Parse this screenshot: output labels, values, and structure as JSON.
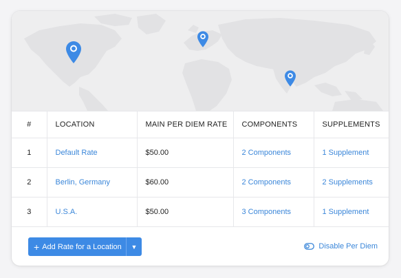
{
  "table": {
    "headers": {
      "num": "#",
      "location": "LOCATION",
      "rate": "MAIN PER DIEM RATE",
      "components": "COMPONENTS",
      "supplements": "SUPPLEMENTS"
    },
    "rows": [
      {
        "num": "1",
        "location": "Default Rate",
        "rate": "$50.00",
        "components": "2 Components",
        "supplements": "1 Supplement"
      },
      {
        "num": "2",
        "location": "Berlin, Germany",
        "rate": "$60.00",
        "components": "2 Components",
        "supplements": "2 Supplements"
      },
      {
        "num": "3",
        "location": "U.S.A.",
        "rate": "$50.00",
        "components": "3 Components",
        "supplements": "1 Supplement"
      }
    ]
  },
  "footer": {
    "add_icon": "+",
    "add_label": "Add Rate for a Location",
    "dropdown_icon": "▼",
    "disable_label": "Disable Per Diem"
  },
  "map": {
    "pins": [
      "map-pin-usa",
      "map-pin-germany",
      "map-pin-india"
    ],
    "pin_color": "#3d8ae5",
    "land_color": "#e2e2e4"
  },
  "icons": [
    "plus-icon",
    "chevron-down-icon",
    "toggle-icon",
    "map-pin-icon"
  ]
}
